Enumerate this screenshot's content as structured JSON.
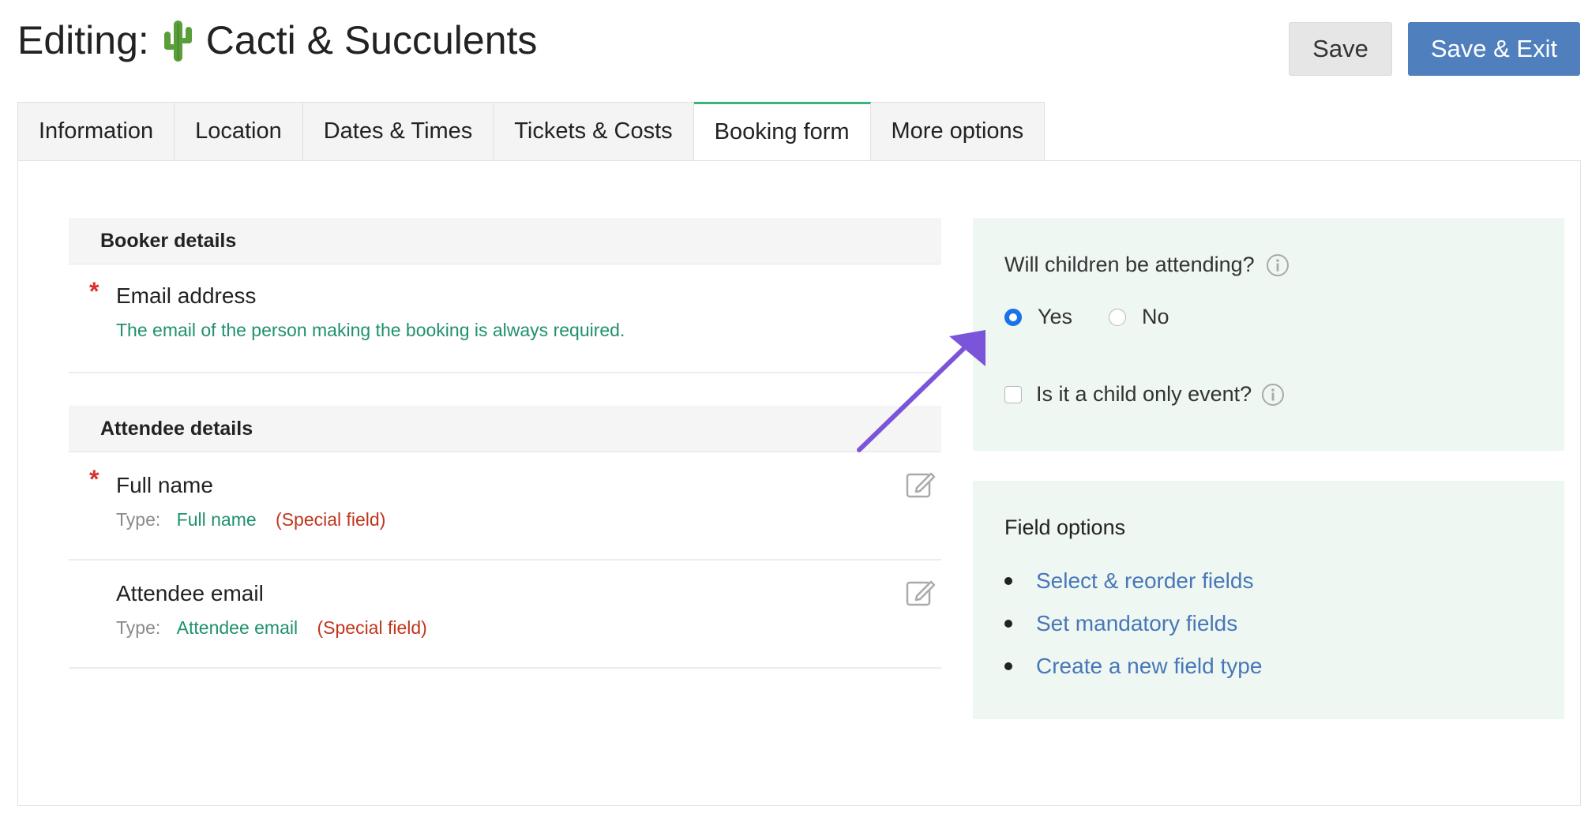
{
  "header": {
    "title_prefix": "Editing:",
    "title_icon": "cactus-emoji",
    "title_name": "Cacti & Succulents",
    "save_label": "Save",
    "save_exit_label": "Save & Exit",
    "accent": "#4f7fbd"
  },
  "tabs": [
    {
      "label": "Information",
      "active": false
    },
    {
      "label": "Location",
      "active": false
    },
    {
      "label": "Dates & Times",
      "active": false
    },
    {
      "label": "Tickets & Costs",
      "active": false
    },
    {
      "label": "Booking form",
      "active": true
    },
    {
      "label": "More options",
      "active": false
    }
  ],
  "booker": {
    "heading": "Booker details",
    "email_label": "Email address",
    "email_note": "The email of the person making the booking is always required."
  },
  "attendee": {
    "heading": "Attendee details",
    "fields": [
      {
        "label": "Full name",
        "type_prefix": "Type:",
        "type": "Full name",
        "tag": "(Special field)",
        "required": true
      },
      {
        "label": "Attendee email",
        "type_prefix": "Type:",
        "type": "Attendee email",
        "tag": "(Special field)",
        "required": false
      }
    ]
  },
  "children": {
    "question": "Will children be attending?",
    "yes_label": "Yes",
    "no_label": "No",
    "selected": "Yes",
    "child_only_label": "Is it a child only event?",
    "child_only_checked": false
  },
  "field_options": {
    "title": "Field options",
    "links": [
      "Select & reorder fields",
      "Set mandatory fields",
      "Create a new field type"
    ]
  },
  "annotation_color": "#7b55d9"
}
